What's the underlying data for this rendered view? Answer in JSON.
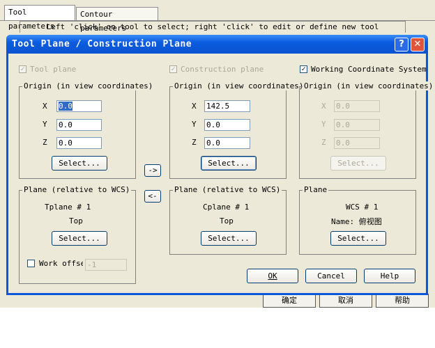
{
  "background": {
    "tabs": [
      "Tool parameters",
      "Contour parameters"
    ],
    "hint": "Left 'click' on tool to select; right 'click' to edit or define new tool",
    "bottom_buttons": [
      "确定",
      "取消",
      "帮助"
    ]
  },
  "dialog": {
    "title": "Tool Plane / Construction Plane",
    "help_glyph": "?",
    "close_glyph": "✕",
    "tool_plane": {
      "checkbox_label": "Tool plane",
      "checked": true,
      "origin_legend": "Origin (in view coordinates)",
      "x_label": "X",
      "y_label": "Y",
      "z_label": "Z",
      "x": "0.0",
      "y": "0.0",
      "z": "0.0",
      "select_label": "Select...",
      "plane_legend": "Plane (relative to WCS)",
      "plane_name": "Tplane # 1",
      "plane_view": "Top",
      "plane_select_label": "Select...",
      "work_offset_label": "Work offset",
      "work_offset_value": "-1"
    },
    "arrow_right": "->",
    "arrow_left": "<-",
    "construction_plane": {
      "checkbox_label": "Construction plane",
      "checked": true,
      "origin_legend": "Origin (in view coordinates)",
      "x_label": "X",
      "y_label": "Y",
      "z_label": "Z",
      "x": "142.5",
      "y": "0.0",
      "z": "0.0",
      "select_label": "Select...",
      "plane_legend": "Plane (relative to WCS)",
      "plane_name": "Cplane # 1",
      "plane_view": "Top",
      "plane_select_label": "Select..."
    },
    "wcs": {
      "checkbox_label": "Working Coordinate System",
      "checked": true,
      "origin_legend": "Origin (in view coordinates)",
      "x_label": "X",
      "y_label": "Y",
      "z_label": "Z",
      "x": "0.0",
      "y": "0.0",
      "z": "0.0",
      "select_label": "Select...",
      "plane_legend": "Plane",
      "plane_name": "WCS # 1",
      "plane_view": "Name: 俯视图",
      "plane_select_label": "Select..."
    },
    "buttons": {
      "ok": "OK",
      "cancel": "Cancel",
      "help": "Help"
    },
    "colors": {
      "titlebar": "#0a58d8",
      "face": "#ece9d8",
      "selection": "#316ac5"
    }
  }
}
